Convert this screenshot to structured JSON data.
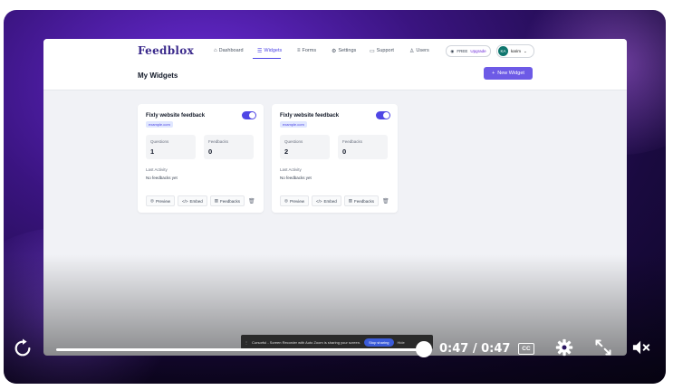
{
  "app": {
    "logo": "Feedblox",
    "nav": [
      {
        "label": "Dashboard",
        "icon": "home-icon",
        "active": false
      },
      {
        "label": "Widgets",
        "icon": "list-icon",
        "active": true
      },
      {
        "label": "Forms",
        "icon": "form-icon",
        "active": false
      },
      {
        "label": "Settings",
        "icon": "gear-icon",
        "active": false
      },
      {
        "label": "Support",
        "icon": "chat-icon",
        "active": false
      },
      {
        "label": "Users",
        "icon": "users-icon",
        "active": false
      }
    ],
    "plan": {
      "label": "FREE",
      "upgrade": "Upgrade"
    },
    "user": {
      "initials": "KA",
      "name": "karim"
    },
    "page_title": "My Widgets",
    "new_widget_label": "New Widget",
    "widgets": [
      {
        "title": "Fixly website feedback",
        "domain": "example.com",
        "enabled": true,
        "questions_label": "Questions",
        "questions": "1",
        "feedbacks_label": "Feedbacks",
        "feedbacks": "0",
        "last_activity_label": "Last Activity",
        "last_activity": "No feedbacks yet",
        "actions": [
          "Preview",
          "Embed",
          "Feedbacks"
        ]
      },
      {
        "title": "Fixly website feedback",
        "domain": "example.com",
        "enabled": true,
        "questions_label": "Questions",
        "questions": "2",
        "feedbacks_label": "Feedbacks",
        "feedbacks": "0",
        "last_activity_label": "Last Activity",
        "last_activity": "No feedbacks yet",
        "actions": [
          "Preview",
          "Embed",
          "Feedbacks"
        ]
      }
    ]
  },
  "share_banner": {
    "text": "Cursorful - Screen Recorder with Auto Zoom is sharing your screen.",
    "stop_label": "Stop sharing",
    "hide_label": "Hide"
  },
  "player": {
    "time": "0:47 / 0:47",
    "progress": 1.0,
    "cc_label": "CC"
  },
  "colors": {
    "accent": "#4f46e5",
    "button": "#6d5ae6",
    "logo": "#3b2a8c",
    "player_bg": "#1a0a40"
  }
}
